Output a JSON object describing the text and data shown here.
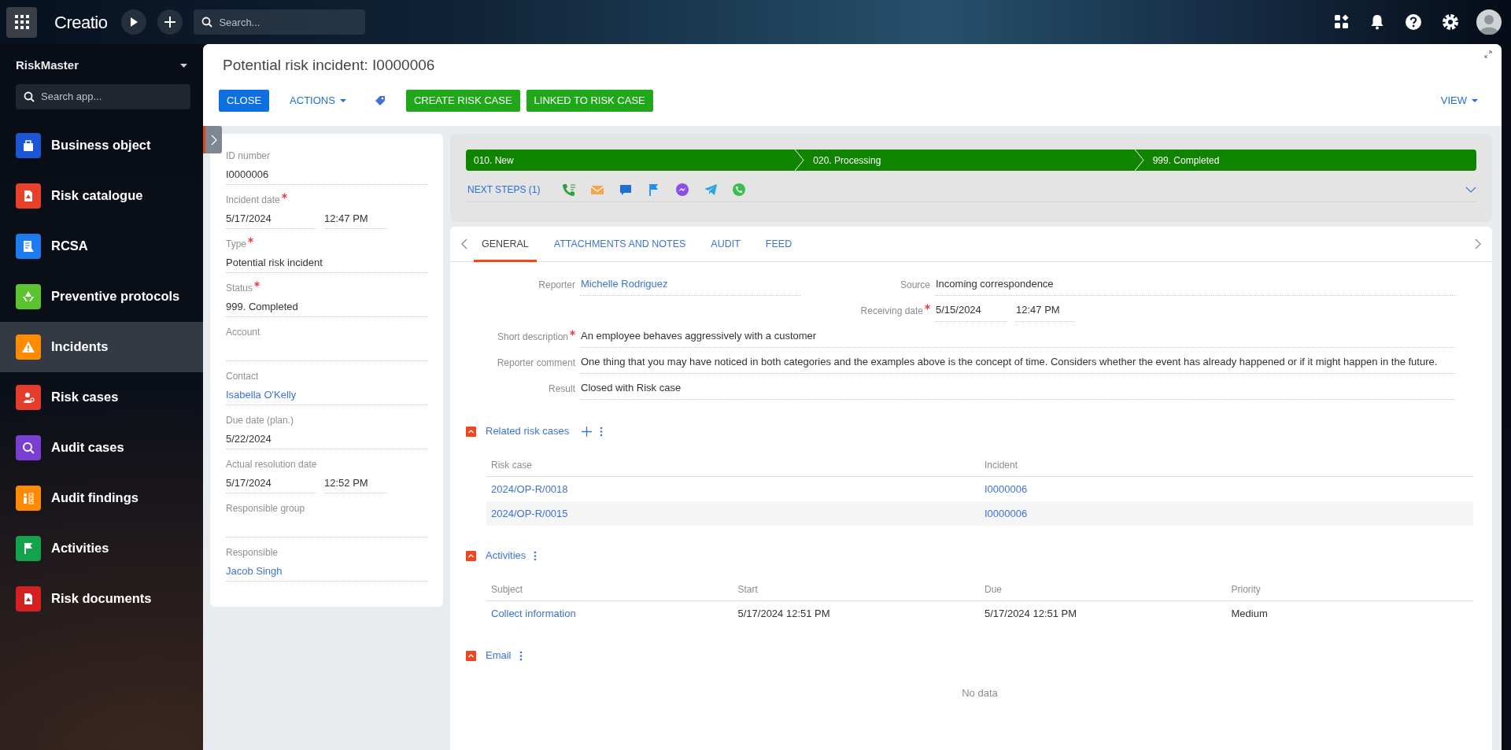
{
  "topbar": {
    "logo": "Creatio",
    "search": {
      "placeholder": "Search..."
    }
  },
  "workspace": {
    "name": "RiskMaster",
    "search": {
      "placeholder": "Search app..."
    }
  },
  "sidebar": {
    "items": [
      {
        "label": "Business object",
        "color": "#1a56d6",
        "selected": false
      },
      {
        "label": "Risk catalogue",
        "color": "#e8402a",
        "selected": false
      },
      {
        "label": "RCSA",
        "color": "#1e7cf0",
        "selected": false
      },
      {
        "label": "Preventive protocols",
        "color": "#5ac531",
        "selected": false
      },
      {
        "label": "Incidents",
        "color": "#ff8c00",
        "selected": true
      },
      {
        "label": "Risk cases",
        "color": "#e43d2c",
        "selected": false
      },
      {
        "label": "Audit cases",
        "color": "#7a3fd1",
        "selected": false
      },
      {
        "label": "Audit findings",
        "color": "#ff8a00",
        "selected": false
      },
      {
        "label": "Activities",
        "color": "#13a34a",
        "selected": false
      },
      {
        "label": "Risk documents",
        "color": "#d42020",
        "selected": false
      }
    ]
  },
  "page": {
    "title": "Potential risk incident: I0000006",
    "actions": [
      {
        "label": "CLOSE",
        "kind": "primary"
      },
      {
        "label": "ACTIONS",
        "kind": "menu"
      },
      {
        "kind": "tag"
      },
      {
        "label": "CREATE RISK CASE",
        "kind": "success"
      },
      {
        "label": "LINKED TO RISK CASE",
        "kind": "success"
      }
    ],
    "view_button": {
      "label": "VIEW"
    }
  },
  "record_fields": [
    {
      "label": "ID number",
      "required": false,
      "value": "I0000006",
      "link": false
    },
    {
      "label": "Incident date",
      "required": true,
      "value": "5/17/2024",
      "time": "12:47 PM",
      "link": false
    },
    {
      "label": "Type",
      "required": true,
      "value": "Potential risk incident",
      "link": false
    },
    {
      "label": "Status",
      "required": true,
      "value": "999. Completed",
      "link": false
    },
    {
      "label": "Account",
      "required": false
    },
    {
      "label": "Contact",
      "required": false,
      "value": "Isabella O'Kelly",
      "link": true
    },
    {
      "label": "Due date (plan.)",
      "required": false,
      "value": "5/22/2024",
      "link": false
    },
    {
      "label": "Actual resolution date",
      "required": false,
      "value": "5/17/2024",
      "time": "12:52 PM",
      "link": false
    },
    {
      "label": "Responsible group",
      "required": false
    },
    {
      "label": "Responsible",
      "required": false,
      "value": "Jacob Singh",
      "link": true
    }
  ],
  "stages": [
    {
      "label": "010. New",
      "completed": true
    },
    {
      "label": "020. Processing",
      "completed": true
    },
    {
      "label": "999. Completed",
      "completed": true
    }
  ],
  "next_steps": {
    "label": "NEXT STEPS (1)"
  },
  "tabs": [
    {
      "label": "GENERAL",
      "selected": true
    },
    {
      "label": "ATTACHMENTS AND NOTES",
      "selected": false
    },
    {
      "label": "AUDIT",
      "selected": false
    },
    {
      "label": "FEED",
      "selected": false
    }
  ],
  "details": {
    "left": [
      {
        "label": "Reporter",
        "required": false,
        "value": "Michelle Rodriguez",
        "link": true
      }
    ],
    "right": [
      {
        "label": "Source",
        "required": false,
        "value": "Incoming correspondence",
        "link": false
      },
      {
        "label": "Receiving date",
        "required": true,
        "value": "5/15/2024",
        "time": "12:47 PM",
        "link": false
      }
    ],
    "full": [
      {
        "label": "Short description",
        "required": true,
        "value": "An employee behaves aggressively with a customer",
        "link": false
      },
      {
        "label": "Reporter comment",
        "required": false,
        "value": "One thing that you may have noticed in both categories and the examples above is the concept of time. Considers whether the event has already happened or if it might happen in the future.",
        "link": false
      },
      {
        "label": "Result",
        "required": false,
        "value": "Closed with Risk case",
        "link": false
      }
    ]
  },
  "sections": [
    {
      "title": "Related risk cases",
      "expanded": true,
      "can_add": true,
      "columns": [
        "Risk case",
        "Incident"
      ],
      "rows": [
        [
          {
            "text": "2024/OP-R/0018",
            "link": true
          },
          {
            "text": "I0000006",
            "link": true
          }
        ],
        [
          {
            "text": "2024/OP-R/0015",
            "link": true
          },
          {
            "text": "I0000006",
            "link": true
          }
        ]
      ]
    },
    {
      "title": "Activities",
      "expanded": true,
      "can_add": false,
      "columns": [
        "Subject",
        "Start",
        "Due",
        "Priority"
      ],
      "rows": [
        [
          {
            "text": "Collect information",
            "link": true
          },
          {
            "text": "5/17/2024 12:51 PM",
            "link": false
          },
          {
            "text": "5/17/2024 12:51 PM",
            "link": false
          },
          {
            "text": "Medium",
            "link": false
          }
        ]
      ]
    },
    {
      "title": "Email",
      "expanded": true,
      "can_add": false,
      "empty_text": "No data"
    }
  ]
}
